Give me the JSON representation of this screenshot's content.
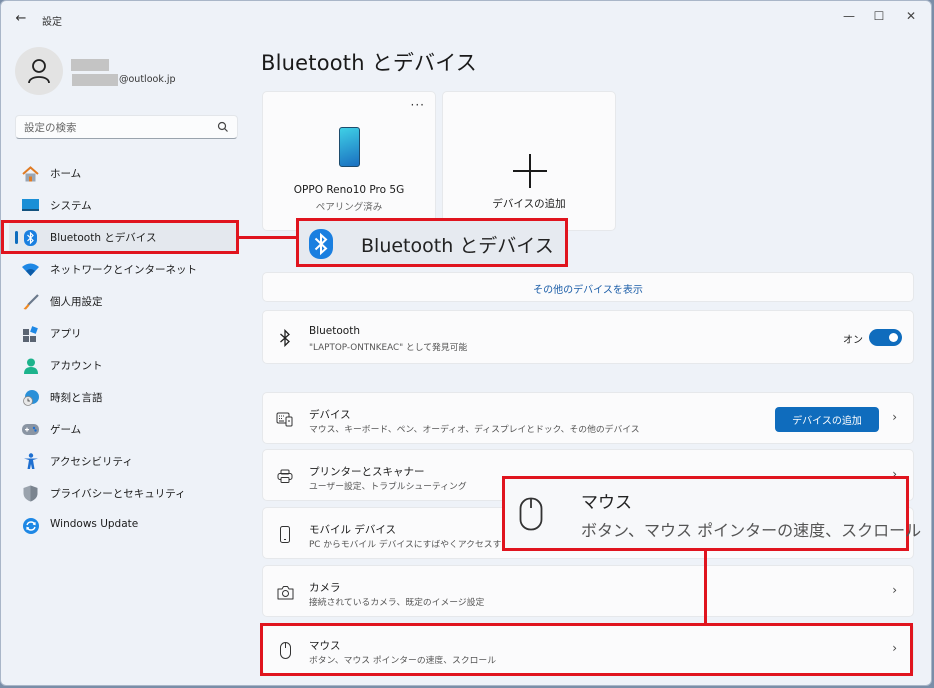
{
  "window": {
    "title": "設定",
    "controls": {
      "minimize": "—",
      "maximize": "☐",
      "close": "✕"
    },
    "back_glyph": "←"
  },
  "profile": {
    "email_suffix": "@outlook.jp"
  },
  "search": {
    "placeholder": "設定の検索"
  },
  "sidebar": {
    "items": [
      {
        "label": "ホーム",
        "icon": "home-icon"
      },
      {
        "label": "システム",
        "icon": "system-icon"
      },
      {
        "label": "Bluetooth とデバイス",
        "icon": "bluetooth-icon",
        "active": true
      },
      {
        "label": "ネットワークとインターネット",
        "icon": "wifi-icon"
      },
      {
        "label": "個人用設定",
        "icon": "brush-icon"
      },
      {
        "label": "アプリ",
        "icon": "apps-icon"
      },
      {
        "label": "アカウント",
        "icon": "account-icon"
      },
      {
        "label": "時刻と言語",
        "icon": "time-language-icon"
      },
      {
        "label": "ゲーム",
        "icon": "gamepad-icon"
      },
      {
        "label": "アクセシビリティ",
        "icon": "accessibility-icon"
      },
      {
        "label": "プライバシーとセキュリティ",
        "icon": "shield-icon"
      },
      {
        "label": "Windows Update",
        "icon": "update-icon"
      }
    ]
  },
  "main": {
    "title": "Bluetooth とデバイス",
    "device_card": {
      "name": "OPPO Reno10 Pro 5G",
      "status": "ペアリング済み",
      "more": "···"
    },
    "add_card": {
      "label": "デバイスの追加"
    },
    "more_devices_link": "その他のデバイスを表示",
    "bluetooth": {
      "title": "Bluetooth",
      "subtitle": "\"LAPTOP-ONTNKEAC\" として発見可能",
      "toggle_label": "オン",
      "toggle_on": true
    },
    "rows": [
      {
        "title": "デバイス",
        "subtitle": "マウス、キーボード、ペン、オーディオ、ディスプレイとドック、その他のデバイス",
        "button": "デバイスの追加",
        "chevron": "›"
      },
      {
        "title": "プリンターとスキャナー",
        "subtitle": "ユーザー設定、トラブルシューティング",
        "chevron": "›"
      },
      {
        "title": "モバイル デバイス",
        "subtitle": "PC からモバイル デバイスにすばやくアクセスする",
        "chevron": "›"
      },
      {
        "title": "カメラ",
        "subtitle": "接続されているカメラ、既定のイメージ設定",
        "chevron": "›"
      },
      {
        "title": "マウス",
        "subtitle": "ボタン、マウス ポインターの速度、スクロール",
        "chevron": "›"
      }
    ]
  },
  "annotations": {
    "bluetooth_callout": "Bluetooth とデバイス",
    "mouse_callout": {
      "title": "マウス",
      "subtitle": "ボタン、マウス ポインターの速度、スクロール"
    },
    "color": "#e0141e"
  }
}
